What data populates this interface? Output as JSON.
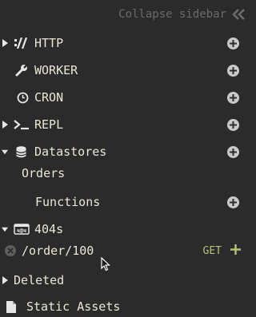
{
  "header": {
    "collapse_label": "Collapse sidebar",
    "collapse_icon": "double-chevron-left-icon"
  },
  "items": {
    "http": {
      "label": "HTTP",
      "icon": "http-icon"
    },
    "worker": {
      "label": "WORKER",
      "icon": "wrench-icon"
    },
    "cron": {
      "label": "CRON",
      "icon": "clock-icon"
    },
    "repl": {
      "label": "REPL",
      "icon": "terminal-icon"
    },
    "datastores": {
      "label": "Datastores",
      "icon": "database-icon"
    },
    "orders": {
      "label": "Orders"
    },
    "functions": {
      "label": "Functions"
    },
    "f404s": {
      "label": "404s",
      "icon": "404-icon"
    },
    "order_route": {
      "label": "/order/100",
      "method": "GET"
    },
    "deleted": {
      "label": "Deleted"
    },
    "static_assets": {
      "label": "Static Assets",
      "icon": "file-icon"
    }
  },
  "colors": {
    "background": "#2b2b2b",
    "text": "#ebe6d6",
    "muted": "#6a6a6a",
    "accent_green": "#b6c27a",
    "plus_circle": "#c9c9c9"
  }
}
